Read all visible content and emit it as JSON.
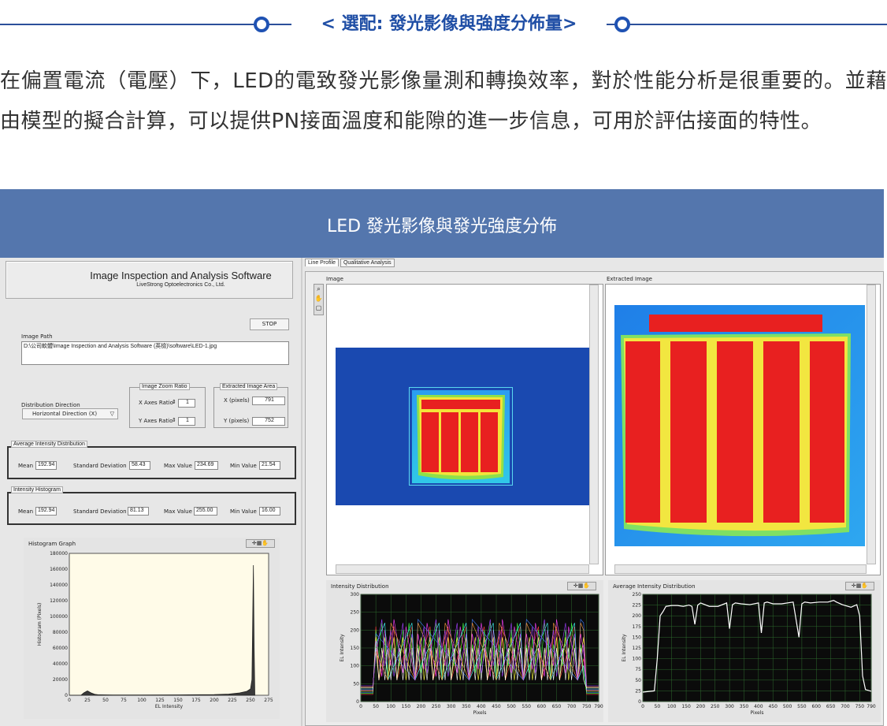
{
  "header": {
    "title": "< 選配: 發光影像與強度分佈量>"
  },
  "intro": "在偏置電流（電壓）下，LED的電致發光影像量測和轉換效率，對於性能分析是很重要的。並藉由模型的擬合計算，可以提供PN接面溫度和能隙的進一步信息，可用於評估接面的特性。",
  "banner": {
    "title": "LED 發光影像與發光強度分佈"
  },
  "app": {
    "title": "Image Inspection and Analysis Software",
    "company": "LiveStrong Optoelectronics Co., Ltd.",
    "stop_label": "STOP",
    "image_path_label": "Image Path",
    "image_path_value": "D:\\公司軟體\\Image Inspection and Analysis Software (英檢)\\software\\LED-1.jpg",
    "distribution_direction_label": "Distribution Direction",
    "distribution_direction_value": "Horizontal Direction (X)",
    "zoom_group_label": "Image Zoom Ratio",
    "x_ratio_label": "X Axes Ratio",
    "x_ratio_value": "1",
    "y_ratio_label": "Y Axes Ratio",
    "y_ratio_value": "1",
    "extract_group_label": "Extracted Image Area",
    "x_pixels_label": "X (pixels)",
    "x_pixels_value": "791",
    "y_pixels_label": "Y (pixels)",
    "y_pixels_value": "752",
    "avg_group_label": "Average Intensity Distribution",
    "hist_group_label": "Intensity Histogram",
    "mean_label": "Mean",
    "std_label": "Standard Deviation",
    "max_label": "Max Value",
    "min_label": "Min Value",
    "avg_mean": "192.94",
    "avg_std": "58.43",
    "avg_max": "234.69",
    "avg_min": "21.54",
    "hist_mean": "192.94",
    "hist_std": "81.13",
    "hist_max": "255.00",
    "hist_min": "16.00",
    "tabs": [
      "Line Profile",
      "Qualitative Analysis"
    ],
    "image_label": "Image",
    "extracted_label": "Extracted Image"
  },
  "colors": {
    "banner": "#5476ad",
    "header_accent": "#1f52b3",
    "plot_bg": "#0b0b0b",
    "histogram_bg": "#fffbe8"
  },
  "chart_data": [
    {
      "type": "area",
      "title": "Histogram Graph",
      "xlabel": "EL Intensity",
      "ylabel": "Histogram (Pixels)",
      "xlim": [
        0,
        275
      ],
      "ylim": [
        0,
        180000
      ],
      "xticks": [
        0,
        25,
        50,
        75,
        100,
        125,
        150,
        175,
        200,
        225,
        250,
        275
      ],
      "yticks": [
        0,
        20000,
        40000,
        60000,
        80000,
        100000,
        120000,
        140000,
        160000,
        180000
      ],
      "x": [
        0,
        16,
        20,
        25,
        30,
        35,
        40,
        60,
        100,
        150,
        200,
        220,
        235,
        245,
        250,
        252,
        254,
        255,
        256
      ],
      "y": [
        0,
        0,
        3000,
        5500,
        3000,
        1200,
        600,
        300,
        400,
        500,
        800,
        1500,
        3000,
        5000,
        8000,
        20000,
        165000,
        60000,
        0
      ]
    },
    {
      "type": "line",
      "title": "Intensity Distribution",
      "xlabel": "Pixels",
      "ylabel": "EL Intensity",
      "xlim": [
        0,
        790
      ],
      "ylim": [
        0,
        300
      ],
      "xticks": [
        0,
        50,
        100,
        150,
        200,
        250,
        300,
        350,
        400,
        450,
        500,
        550,
        600,
        650,
        700,
        750,
        790
      ],
      "yticks": [
        0,
        50,
        100,
        150,
        200,
        250,
        300
      ],
      "grid": true
    },
    {
      "type": "line",
      "title": "Average Intensity Distribution",
      "xlabel": "Pixels",
      "ylabel": "EL Intensity",
      "xlim": [
        0,
        790
      ],
      "ylim": [
        0,
        250
      ],
      "xticks": [
        0,
        50,
        100,
        150,
        200,
        250,
        300,
        350,
        400,
        450,
        500,
        550,
        600,
        650,
        700,
        750,
        790
      ],
      "yticks": [
        0,
        25,
        50,
        75,
        100,
        125,
        150,
        175,
        200,
        225,
        250
      ],
      "grid": true,
      "x": [
        0,
        40,
        50,
        60,
        70,
        80,
        100,
        120,
        140,
        160,
        170,
        180,
        190,
        200,
        230,
        260,
        290,
        300,
        310,
        320,
        340,
        370,
        400,
        410,
        420,
        430,
        450,
        480,
        520,
        540,
        550,
        560,
        580,
        610,
        640,
        660,
        670,
        690,
        720,
        740,
        750,
        760,
        770,
        790
      ],
      "y": [
        22,
        25,
        100,
        200,
        210,
        222,
        224,
        224,
        222,
        225,
        222,
        180,
        225,
        230,
        222,
        222,
        230,
        170,
        226,
        230,
        228,
        226,
        230,
        160,
        230,
        232,
        228,
        228,
        232,
        150,
        228,
        232,
        230,
        232,
        232,
        236,
        232,
        226,
        220,
        226,
        200,
        60,
        28,
        24
      ]
    }
  ]
}
